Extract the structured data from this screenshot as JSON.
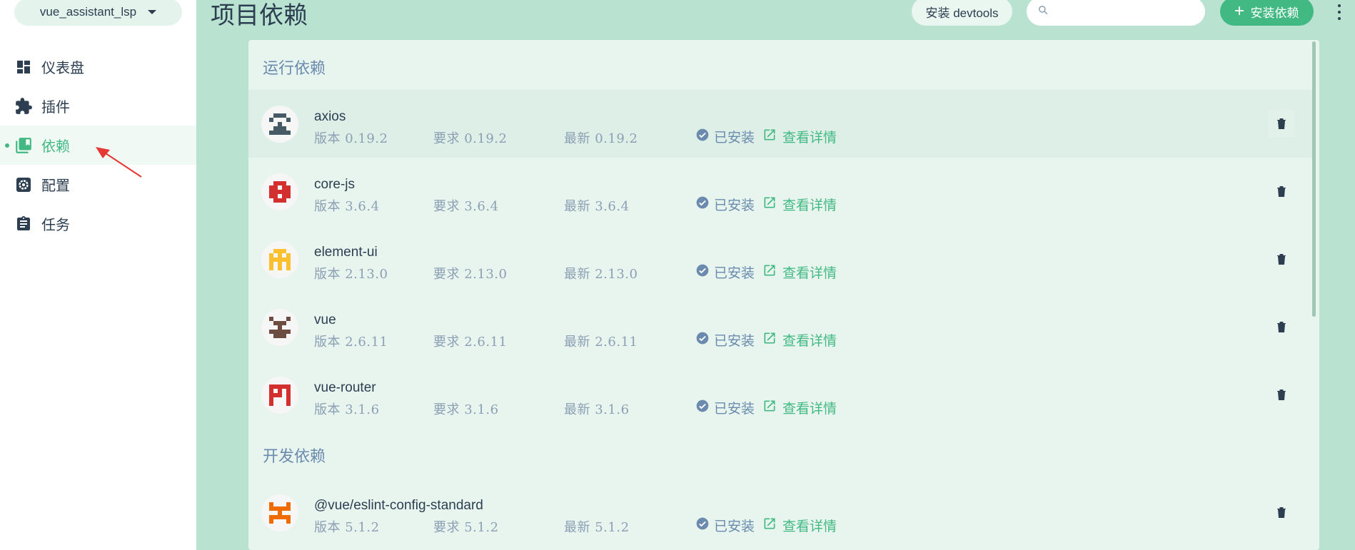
{
  "sidebar": {
    "project": "vue_assistant_lsp",
    "items": [
      {
        "label": "仪表盘",
        "icon": "dashboard-icon"
      },
      {
        "label": "插件",
        "icon": "puzzle-icon"
      },
      {
        "label": "依赖",
        "icon": "library-icon",
        "active": true
      },
      {
        "label": "配置",
        "icon": "settings-icon"
      },
      {
        "label": "任务",
        "icon": "clipboard-icon"
      }
    ]
  },
  "header": {
    "title": "项目依赖",
    "devtools_label": "安装 devtools",
    "search_placeholder": "",
    "install_label": "安装依赖"
  },
  "sections": [
    {
      "title": "运行依赖",
      "deps": [
        {
          "name": "axios",
          "version": "版本 0.19.2",
          "wanted": "要求 0.19.2",
          "latest": "最新 0.19.2",
          "status": "已安装",
          "details": "查看详情",
          "color": "#455a64"
        },
        {
          "name": "core-js",
          "version": "版本 3.6.4",
          "wanted": "要求 3.6.4",
          "latest": "最新 3.6.4",
          "status": "已安装",
          "details": "查看详情",
          "color": "#d32f2f"
        },
        {
          "name": "element-ui",
          "version": "版本 2.13.0",
          "wanted": "要求 2.13.0",
          "latest": "最新 2.13.0",
          "status": "已安装",
          "details": "查看详情",
          "color": "#fbc02d"
        },
        {
          "name": "vue",
          "version": "版本 2.6.11",
          "wanted": "要求 2.6.11",
          "latest": "最新 2.6.11",
          "status": "已安装",
          "details": "查看详情",
          "color": "#6d4c41"
        },
        {
          "name": "vue-router",
          "version": "版本 3.1.6",
          "wanted": "要求 3.1.6",
          "latest": "最新 3.1.6",
          "status": "已安装",
          "details": "查看详情",
          "color": "#d32f2f"
        }
      ]
    },
    {
      "title": "开发依赖",
      "deps": [
        {
          "name": "@vue/eslint-config-standard",
          "version": "版本 5.1.2",
          "wanted": "要求 5.1.2",
          "latest": "最新 5.1.2",
          "status": "已安装",
          "details": "查看详情",
          "color": "#ef6c00"
        }
      ]
    }
  ],
  "colors": {
    "accent": "#42b983",
    "muted": "#6a8bad",
    "text": "#2c3e50"
  }
}
